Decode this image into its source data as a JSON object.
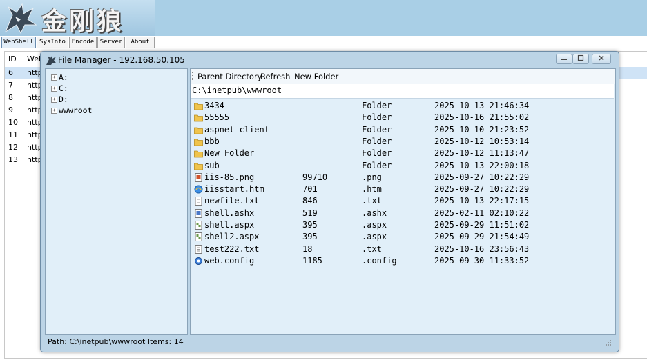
{
  "app": {
    "logo_text": "金刚狼",
    "menu": [
      "WebShell",
      "SysInfo",
      "Encode",
      "Server",
      "About"
    ],
    "list_headers": [
      "ID",
      "Web"
    ],
    "rows": [
      {
        "id": "6",
        "url": "http"
      },
      {
        "id": "7",
        "url": "http"
      },
      {
        "id": "8",
        "url": "http"
      },
      {
        "id": "9",
        "url": "http"
      },
      {
        "id": "10",
        "url": "http"
      },
      {
        "id": "11",
        "url": "http"
      },
      {
        "id": "12",
        "url": "http"
      },
      {
        "id": "13",
        "url": "http"
      }
    ]
  },
  "dialog": {
    "title": "File Manager - 192.168.50.105",
    "tree": [
      "A:",
      "C:",
      "D:",
      "wwwroot"
    ],
    "toolbar": {
      "parent": "Parent Directory",
      "refresh": "Refresh",
      "new_folder": "New Folder"
    },
    "path": "C:\\inetpub\\wwwroot",
    "files": [
      {
        "name": "3434",
        "size": "",
        "type": "Folder",
        "date": "2025-10-13 21:46:34",
        "icon": "folder-icon"
      },
      {
        "name": "55555",
        "size": "",
        "type": "Folder",
        "date": "2025-10-16 21:55:02",
        "icon": "folder-icon"
      },
      {
        "name": "aspnet_client",
        "size": "",
        "type": "Folder",
        "date": "2025-10-10 21:23:52",
        "icon": "folder-icon"
      },
      {
        "name": "bbb",
        "size": "",
        "type": "Folder",
        "date": "2025-10-12 10:53:14",
        "icon": "folder-icon"
      },
      {
        "name": "New Folder",
        "size": "",
        "type": "Folder",
        "date": "2025-10-12 11:13:47",
        "icon": "folder-icon"
      },
      {
        "name": "sub",
        "size": "",
        "type": "Folder",
        "date": "2025-10-13 22:00:18",
        "icon": "folder-icon"
      },
      {
        "name": "iis-85.png",
        "size": "99710",
        "type": ".png",
        "date": "2025-09-27 10:22:29",
        "icon": "image-file-icon"
      },
      {
        "name": "iisstart.htm",
        "size": "701",
        "type": ".htm",
        "date": "2025-09-27 10:22:29",
        "icon": "html-file-icon"
      },
      {
        "name": "newfile.txt",
        "size": "846",
        "type": ".txt",
        "date": "2025-10-13 22:17:15",
        "icon": "text-file-icon"
      },
      {
        "name": "shell.ashx",
        "size": "519",
        "type": ".ashx",
        "date": "2025-02-11 02:10:22",
        "icon": "script-file-icon"
      },
      {
        "name": "shell.aspx",
        "size": "395",
        "type": ".aspx",
        "date": "2025-09-29 11:51:02",
        "icon": "aspx-file-icon"
      },
      {
        "name": "shell2.aspx",
        "size": "395",
        "type": ".aspx",
        "date": "2025-09-29 21:54:49",
        "icon": "aspx-file-icon"
      },
      {
        "name": "test222.txt",
        "size": "18",
        "type": ".txt",
        "date": "2025-10-16 23:56:43",
        "icon": "text-file-icon"
      },
      {
        "name": "web.config",
        "size": "1185",
        "type": ".config",
        "date": "2025-09-30 11:33:52",
        "icon": "config-file-icon"
      }
    ],
    "status": "Path: C:\\inetpub\\wwwroot  Items: 14"
  },
  "colors": {
    "banner": "#a9cfe6",
    "dialog_frame": "#bcd4e6",
    "pane_bg": "#e1eff9",
    "folder": "#f0c44c"
  }
}
